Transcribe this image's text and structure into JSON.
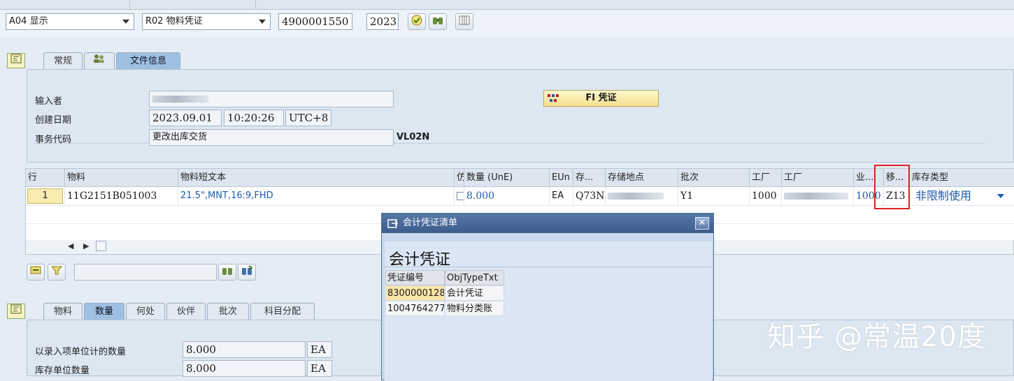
{
  "toolbar": {
    "action_value": "A04 显示",
    "ref_value": "R02 物料凭证",
    "doc_number": "4900001550",
    "year": "2023",
    "icons": [
      "execute-icon",
      "binoculars-icon",
      "grid-icon"
    ]
  },
  "header": {
    "tabs": [
      {
        "label": "常规"
      },
      {
        "label": "",
        "icon": "people-icon"
      },
      {
        "label": "文件信息",
        "active": true
      }
    ],
    "fields": {
      "entered_by_label": "输入者",
      "created_on_label": "创建日期",
      "created_date": "2023.09.01",
      "created_time": "10:20:26",
      "timezone": "UTC+8",
      "tcode_label": "事务代码",
      "tcode_text": "更改出库交货",
      "tcode": "VL02N"
    },
    "fi_button": "FI 凭证"
  },
  "items_table": {
    "columns": [
      "行",
      "物料",
      "物料短文本",
      "仿",
      "数量 (UnE)",
      "EUn",
      "存...",
      "存储地点",
      "批次",
      "工厂",
      "工厂",
      "业...",
      "移...",
      "库存类型"
    ],
    "row": {
      "line": "1",
      "material": "11G2151B051003",
      "short_text": "21.5\",MNT,16:9,FHD",
      "quantity": "8.000",
      "eun": "EA",
      "sloc_code": "Q73N",
      "batch": "Y1",
      "plant": "1000",
      "business": "1000",
      "movement": "Z13",
      "stock_type": "非限制使用"
    }
  },
  "item_detail": {
    "tabs": [
      {
        "label": "物料"
      },
      {
        "label": "数量",
        "active": true
      },
      {
        "label": "何处"
      },
      {
        "label": "伙伴"
      },
      {
        "label": "批次"
      },
      {
        "label": "科目分配"
      }
    ],
    "qty_entry_label": "以录入项单位计的数量",
    "qty_entry_value": "8.000",
    "qty_entry_unit": "EA",
    "qty_stock_label": "库存单位数量",
    "qty_stock_value": "8.000",
    "qty_stock_unit": "EA"
  },
  "dialog": {
    "title": "会计凭证清单",
    "heading": "会计凭证",
    "columns": [
      "凭证编号",
      "ObjTypeTxt"
    ],
    "rows": [
      {
        "number": "8300000128",
        "type": "会计凭证"
      },
      {
        "number": "1004764277",
        "type": "物料分类账"
      }
    ]
  },
  "watermark": "知乎 @常温20度",
  "colors": {
    "background": "#e4ecf5",
    "active_tab": "#9ec1e3",
    "highlight": "#f8ecb2",
    "link_blue": "#1d5aa8",
    "dialog_title": "#3b5b8c",
    "annotation_red": "#e02020"
  }
}
